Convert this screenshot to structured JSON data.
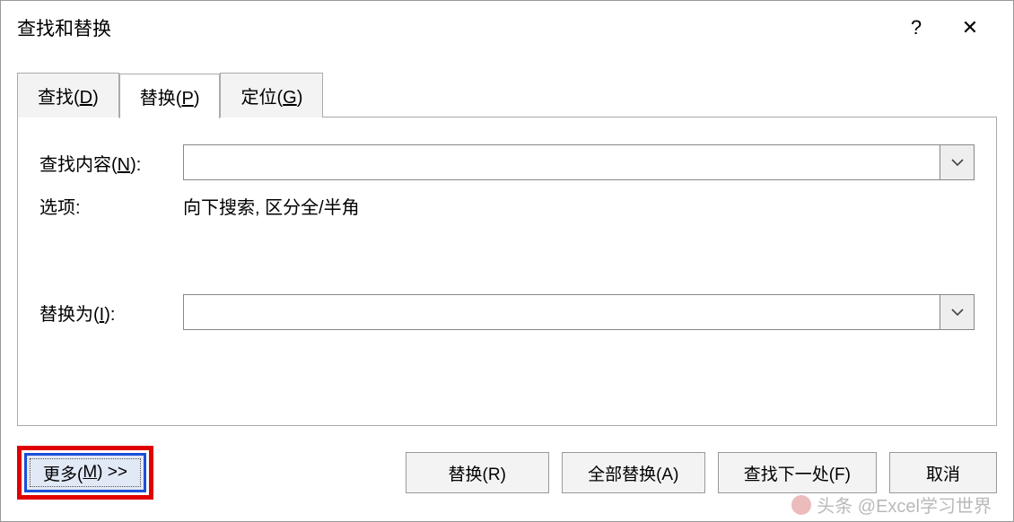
{
  "titlebar": {
    "title": "查找和替换",
    "help": "?",
    "close": "✕"
  },
  "tabs": {
    "find": {
      "pre": "查找(",
      "key": "D",
      "post": ")"
    },
    "replace": {
      "pre": "替换(",
      "key": "P",
      "post": ")"
    },
    "goto": {
      "pre": "定位(",
      "key": "G",
      "post": ")"
    }
  },
  "fields": {
    "find_label_pre": "查找内容(",
    "find_label_key": "N",
    "find_label_post": "):",
    "find_value": "",
    "options_label": "选项:",
    "options_value": "向下搜索, 区分全/半角",
    "replace_label_pre": "替换为(",
    "replace_label_key": "I",
    "replace_label_post": "):",
    "replace_value": ""
  },
  "buttons": {
    "more_pre": "更多(",
    "more_key": "M",
    "more_post": ") >>",
    "replace_one": "替换(R)",
    "replace_all": "全部替换(A)",
    "find_next": "查找下一处(F)",
    "cancel": "取消"
  },
  "watermark": "头条 @Excel学习世界"
}
